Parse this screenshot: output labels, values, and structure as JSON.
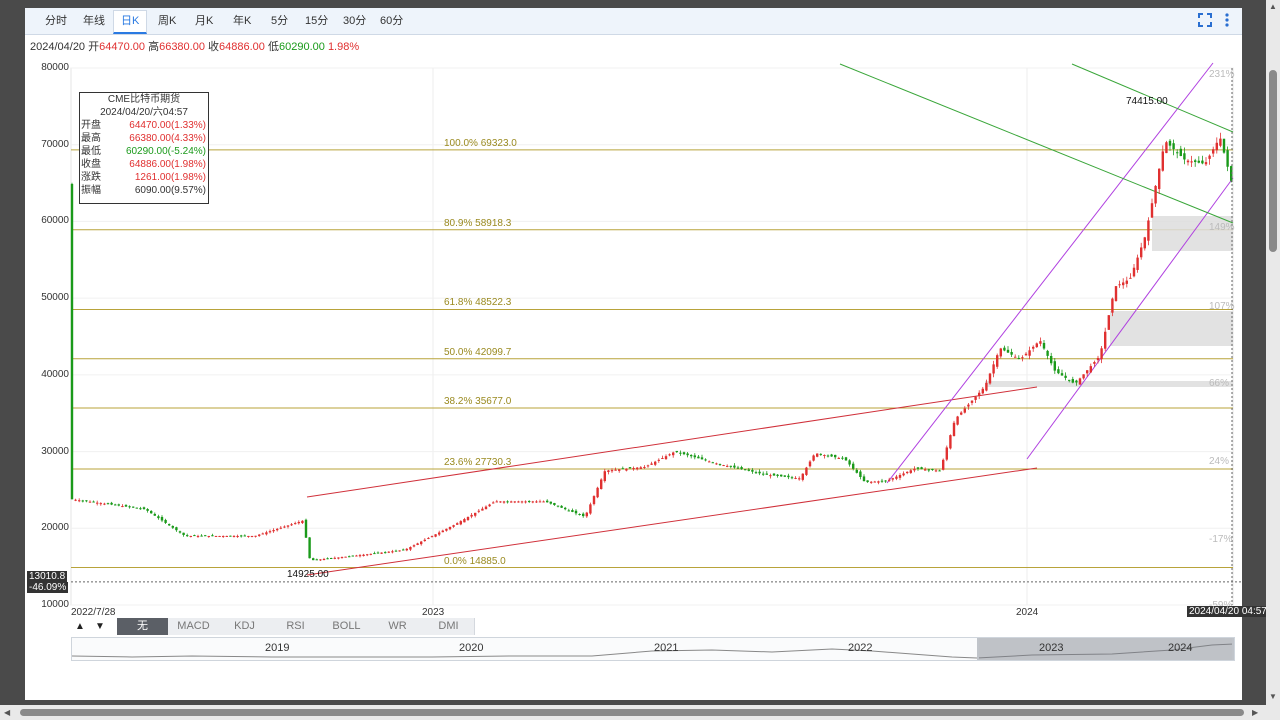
{
  "tabs": [
    {
      "label": "分时",
      "active": false
    },
    {
      "label": "年线",
      "active": false
    },
    {
      "label": "日K",
      "active": true
    },
    {
      "label": "周K",
      "active": false
    },
    {
      "label": "月K",
      "active": false
    },
    {
      "label": "年K",
      "active": false
    },
    {
      "label": "5分",
      "active": false
    },
    {
      "label": "15分",
      "active": false
    },
    {
      "label": "30分",
      "active": false
    },
    {
      "label": "60分",
      "active": false
    }
  ],
  "controls": {
    "expand_icon": "expand-icon",
    "more_icon": "more-vertical-icon"
  },
  "infoline": {
    "date": "2024/04/20",
    "open_label": "开",
    "open": "64470.00",
    "high_label": "高",
    "high": "66380.00",
    "close_label": "收",
    "close": "64886.00",
    "low_label": "低",
    "low": "60290.00",
    "change": "1.98%"
  },
  "infobox": {
    "title": "CME比特币期货",
    "datetime": "2024/04/20/六04:57",
    "rows": [
      {
        "label": "开盘",
        "value": "64470.00(1.33%)",
        "color": "up"
      },
      {
        "label": "最高",
        "value": "66380.00(4.33%)",
        "color": "up"
      },
      {
        "label": "最低",
        "value": "60290.00(-5.24%)",
        "color": "dn"
      },
      {
        "label": "收盘",
        "value": "64886.00(1.98%)",
        "color": "up"
      },
      {
        "label": "涨跌",
        "value": "1261.00(1.98%)",
        "color": "up"
      },
      {
        "label": "振幅",
        "value": "6090.00(9.57%)",
        "color": "plain"
      }
    ]
  },
  "chart_data": {
    "type": "candlestick",
    "y_ticks": [
      "80000",
      "70000",
      "60000",
      "50000",
      "40000",
      "30000",
      "20000",
      "10000"
    ],
    "ylim": [
      10000,
      80000
    ],
    "pct_ticks": [
      "231%",
      "149%",
      "107%",
      "66%",
      "24%",
      "-17%",
      "-59%"
    ],
    "x_ticks": [
      "2022/7/28",
      "2023",
      "2024"
    ],
    "crosshair": {
      "price": "13010.8",
      "pct": "-46.09%",
      "time": "2024/04/20 04:57"
    },
    "annotations": {
      "high": "74415.00",
      "low": "14925.00"
    },
    "fibonacci": [
      {
        "label": "0.0% 14885.0",
        "value": 14885.0
      },
      {
        "label": "23.6% 27730.3",
        "value": 27730.3
      },
      {
        "label": "38.2% 35677.0",
        "value": 35677.0
      },
      {
        "label": "50.0% 42099.7",
        "value": 42099.7
      },
      {
        "label": "61.8% 48522.3",
        "value": 48522.3
      },
      {
        "label": "80.9% 58918.3",
        "value": 58918.3
      },
      {
        "label": "100.0% 69323.0",
        "value": 69323.0
      }
    ],
    "colors": {
      "up": "#e03030",
      "down": "#1a9a1a",
      "fib": "#b8a33a"
    }
  },
  "indicators": {
    "up_arrow": "▲",
    "down_arrow": "▼",
    "items": [
      "无",
      "MACD",
      "KDJ",
      "RSI",
      "BOLL",
      "WR",
      "DMI"
    ],
    "active": 0
  },
  "navigator": {
    "years": [
      "2019",
      "2020",
      "2021",
      "2022",
      "2023",
      "2024"
    ]
  }
}
